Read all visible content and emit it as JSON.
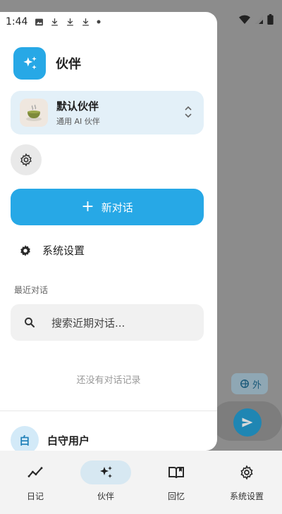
{
  "status_bar": {
    "time": "1:44"
  },
  "brand": {
    "title": "伙伴"
  },
  "persona": {
    "name": "默认伙伴",
    "subtitle": "通用 AI 伙伴"
  },
  "new_chat": {
    "plus": "+",
    "label": "新对话"
  },
  "system_settings": {
    "label": "系统设置"
  },
  "recent": {
    "section_label": "最近对话",
    "search_placeholder": "搜索近期对话...",
    "empty_text": "还没有对话记录"
  },
  "user": {
    "avatar_text": "白",
    "name": "白守用户"
  },
  "backdrop": {
    "chip_label": "外"
  },
  "bottom_nav": {
    "items": [
      {
        "label": "日记",
        "icon": "trend-icon"
      },
      {
        "label": "伙伴",
        "icon": "sparkle-icon",
        "active": true
      },
      {
        "label": "回忆",
        "icon": "book-icon"
      },
      {
        "label": "系统设置",
        "icon": "gear-icon"
      }
    ]
  },
  "colors": {
    "accent": "#27a8e6",
    "persona_bg": "#e3f0f8",
    "nav_active": "#d7e8f2"
  }
}
